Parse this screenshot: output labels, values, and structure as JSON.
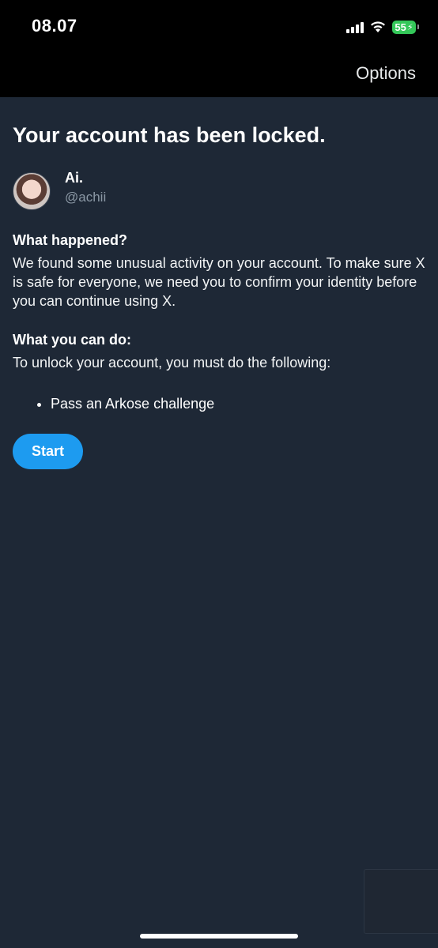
{
  "status_bar": {
    "time": "08.07",
    "battery": "55"
  },
  "header": {
    "options_label": "Options"
  },
  "title": "Your account has been locked.",
  "profile": {
    "name": "Ai.",
    "handle": "@achii"
  },
  "what_happened": {
    "heading": "What happened?",
    "text": "We found some unusual activity on your account. To make sure X is safe for everyone, we need you to confirm your identity before you can continue using X."
  },
  "what_you_can_do": {
    "heading": "What you can do:",
    "text": "To unlock your account, you must do the following:",
    "steps": [
      "Pass an Arkose challenge"
    ]
  },
  "start_label": "Start",
  "colors": {
    "background": "#1e2836",
    "accent": "#1d9bf0",
    "battery": "#34c759"
  }
}
